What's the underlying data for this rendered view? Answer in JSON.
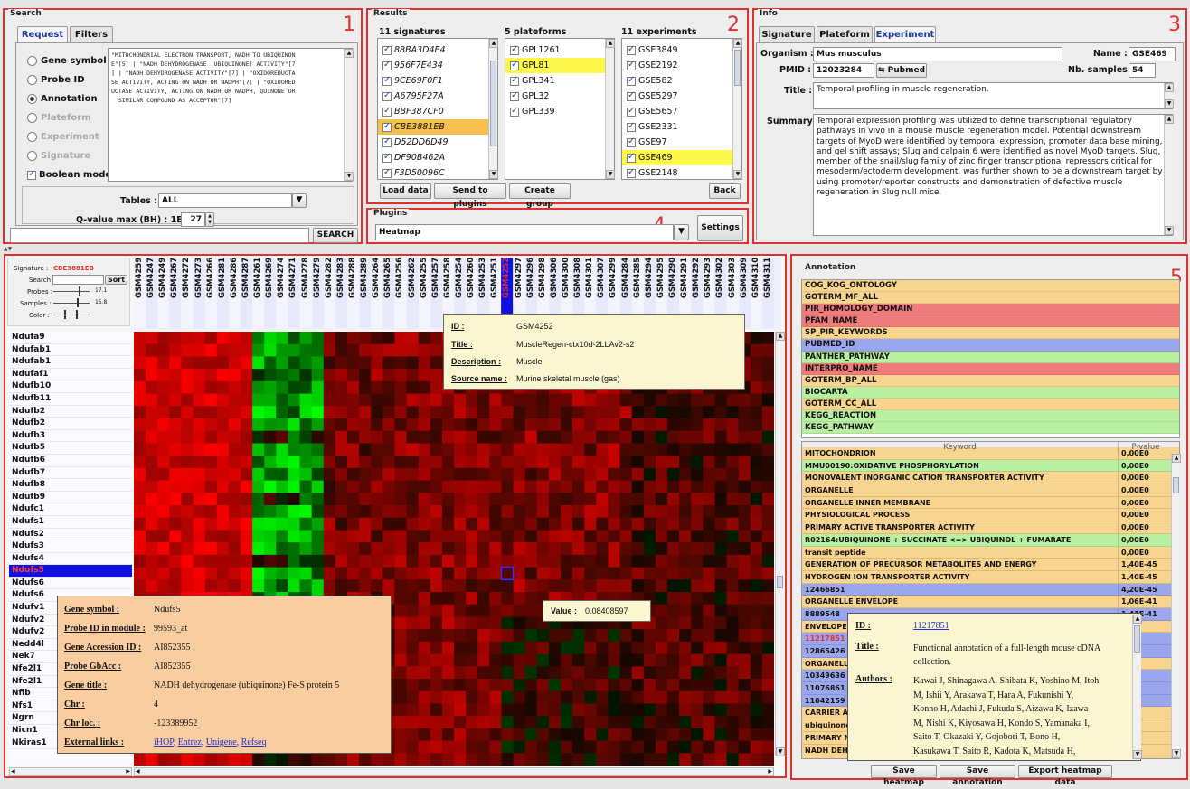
{
  "search": {
    "title": "Search",
    "tabs": [
      "Request",
      "Filters"
    ],
    "options": [
      {
        "label": "Gene symbol",
        "selected": false,
        "enabled": true
      },
      {
        "label": "Probe ID",
        "selected": false,
        "enabled": true
      },
      {
        "label": "Annotation",
        "selected": true,
        "enabled": true
      },
      {
        "label": "Plateform",
        "selected": false,
        "enabled": false
      },
      {
        "label": "Experiment",
        "selected": false,
        "enabled": false
      },
      {
        "label": "Signature",
        "selected": false,
        "enabled": false
      }
    ],
    "boolean_mode": "Boolean mode",
    "query_lines": [
      "\"MITOCHONDRIAL ELECTRON TRANSPORT, NADH TO UBIQUINON",
      "E\"[5] | \"NADH DEHYDROGENASE (UBIQUINONE) ACTIVITY\"[7",
      "] | \"NADH DEHYDROGENASE ACTIVITY\"[7] | \"OXIDOREDUCTA",
      "SE ACTIVITY, ACTING ON NADH OR NADPH\"[7] | \"OXIDORED",
      "UCTASE ACTIVITY, ACTING ON NADH OR NADPH, QUINONE OR",
      "  SIMILAR COMPOUND AS ACCEPTOR\"[7]"
    ],
    "tables_label": "Tables :",
    "tables_value": "ALL",
    "qvalue_label": "Q-value max (BH) : 1E-",
    "qvalue_value": "27",
    "search_button": "SEARCH"
  },
  "results": {
    "title": "Results",
    "signatures_header": "11 signatures",
    "platforms_header": "5 plateforms",
    "experiments_header": "11 experiments",
    "signatures": [
      {
        "id": "88BA3D4E4",
        "state": ""
      },
      {
        "id": "956F7E434",
        "state": ""
      },
      {
        "id": "9CE69F0F1",
        "state": ""
      },
      {
        "id": "A6795F27A",
        "state": ""
      },
      {
        "id": "BBF387CF0",
        "state": ""
      },
      {
        "id": "CBE3881EB",
        "state": "selected"
      },
      {
        "id": "D52DD6D49",
        "state": ""
      },
      {
        "id": "DF90B462A",
        "state": ""
      },
      {
        "id": "F3D50096C",
        "state": ""
      }
    ],
    "platforms": [
      {
        "id": "GPL1261",
        "state": ""
      },
      {
        "id": "GPL81",
        "state": "highlight"
      },
      {
        "id": "GPL341",
        "state": ""
      },
      {
        "id": "GPL32",
        "state": ""
      },
      {
        "id": "GPL339",
        "state": ""
      }
    ],
    "experiments": [
      {
        "id": "GSE3849",
        "state": ""
      },
      {
        "id": "GSE2192",
        "state": ""
      },
      {
        "id": "GSE582",
        "state": ""
      },
      {
        "id": "GSE5297",
        "state": ""
      },
      {
        "id": "GSE5657",
        "state": ""
      },
      {
        "id": "GSE2331",
        "state": ""
      },
      {
        "id": "GSE97",
        "state": ""
      },
      {
        "id": "GSE469",
        "state": "highlight"
      },
      {
        "id": "GSE2148",
        "state": ""
      }
    ],
    "buttons": [
      "Load data",
      "Send to plugins",
      "Create group",
      "Back"
    ]
  },
  "plugins": {
    "title": "Plugins",
    "value": "Heatmap",
    "settings": "Settings"
  },
  "info": {
    "title": "Info",
    "tabs": [
      "Signature",
      "Plateform",
      "Experiment"
    ],
    "organism_label": "Organism :",
    "organism": "Mus musculus",
    "name_label": "Name :",
    "name": "GSE469",
    "pmid_label": "PMID :",
    "pmid": "12023284",
    "pubmed_button": "Pubmed",
    "nb_samples_label": "Nb. samples :",
    "nb_samples": "54",
    "title_label": "Title :",
    "title_value": "Temporal profiling in muscle regeneration.",
    "summary_label": "Summary :",
    "summary_lines": [
      "Temporal expression profiling was utilized to define transcriptional regulatory",
      "pathways in vivo in a mouse muscle regeneration model. Potential downstream",
      "targets of MyoD were identified by temporal expression, promoter data base mining,",
      "and gel shift assays; Slug and calpain 6 were identified as novel MyoD targets. Slug, a",
      "member of the snail/slug family of zinc finger transcriptional repressors critical for",
      "mesoderm/ectoderm development, was further shown to be a downstream target by",
      "using promoter/reporter constructs and demonstration of defective muscle",
      "regeneration in Slug null mice."
    ]
  },
  "heatmap": {
    "signature_label": "Signature :",
    "signature_value": "CBE3881EB",
    "search_label": "Search :",
    "sort_button": "Sort",
    "probes_label": "Probes :",
    "probes_value": "17.1",
    "samples_label": "Samples :",
    "samples_value": "15.8",
    "color_label": "Color :",
    "columns": [
      "GSM4259",
      "GSM4247",
      "GSM4249",
      "GSM4267",
      "GSM4272",
      "GSM4273",
      "GSM4266",
      "GSM4281",
      "GSM4286",
      "GSM4287",
      "GSM4261",
      "GSM4269",
      "GSM4274",
      "GSM4271",
      "GSM4278",
      "GSM4279",
      "GSM4282",
      "GSM4283",
      "GSM4288",
      "GSM4289",
      "GSM4264",
      "GSM4265",
      "GSM4256",
      "GSM4262",
      "GSM4255",
      "GSM4257",
      "GSM4258",
      "GSM4254",
      "GSM4260",
      "GSM4253",
      "GSM4251",
      "GSM4252",
      "GSM4297",
      "GSM4296",
      "GSM4298",
      "GSM4306",
      "GSM4300",
      "GSM4308",
      "GSM4301",
      "GSM4307",
      "GSM4299",
      "GSM4284",
      "GSM4285",
      "GSM4294",
      "GSM4295",
      "GSM4290",
      "GSM4291",
      "GSM4292",
      "GSM4293",
      "GSM4302",
      "GSM4303",
      "GSM4309",
      "GSM4310",
      "GSM4311"
    ],
    "selected_column": "GSM4252",
    "genes": [
      "Ndufa9",
      "Ndufab1",
      "Ndufab1",
      "Ndufaf1",
      "Ndufb10",
      "Ndufb11",
      "Ndufb2",
      "Ndufb2",
      "Ndufb3",
      "Ndufb5",
      "Ndufb6",
      "Ndufb7",
      "Ndufb8",
      "Ndufb9",
      "Ndufc1",
      "Ndufs1",
      "Ndufs2",
      "Ndufs3",
      "Ndufs4",
      "Ndufs5",
      "Ndufs6",
      "Ndufs6",
      "Ndufv1",
      "Ndufv2",
      "Ndufv2",
      "Nedd4l",
      "Nek7",
      "Nfe2l1",
      "Nfe2l1",
      "Nfib",
      "Nfs1",
      "Ngrn",
      "Nicn1",
      "Nkiras1"
    ],
    "selected_gene": "Ndufs5",
    "value_tip": {
      "label": "Value :",
      "value": "0.08408597"
    },
    "sample_tip": {
      "id_label": "ID :",
      "id": "GSM4252",
      "title_label": "Title :",
      "title": "MuscleRegen-ctx10d-2LLAv2-s2",
      "desc_label": "Description :",
      "desc": "Muscle",
      "source_label": "Source name :",
      "source": "Murine skeletal muscle (gas)"
    },
    "gene_tip": {
      "symbol_label": "Gene symbol :",
      "symbol": "Ndufs5",
      "probe_label": "Probe ID in module :",
      "probe": "99593_at",
      "acc_label": "Gene Accession ID :",
      "acc": "AI852355",
      "gbacc_label": "Probe GbAcc :",
      "gbacc": "AI852355",
      "title_label": "Gene title :",
      "title": "NADH dehydrogenase (ubiquinone) Fe-S protein 5",
      "chr_label": "Chr :",
      "chr": "4",
      "loc_label": "Chr loc. :",
      "loc": "-123389952",
      "links_label": "External links :",
      "link_ihop": "iHOP",
      "link_entrez": "Entrez",
      "link_unigene": "Unigene",
      "link_refseq": "Refseq",
      "link_sep": ","
    }
  },
  "annotation": {
    "title": "Annotation",
    "categories": [
      {
        "name": "COG_KOG_ONTOLOGY",
        "color": "#f9d48e"
      },
      {
        "name": "GOTERM_MF_ALL",
        "color": "#f9d48e"
      },
      {
        "name": "PIR_HOMOLOGY_DOMAIN",
        "color": "#ef7b7b"
      },
      {
        "name": "PFAM_NAME",
        "color": "#ef7b7b"
      },
      {
        "name": "SP_PIR_KEYWORDS",
        "color": "#f9d48e"
      },
      {
        "name": "PUBMED_ID",
        "color": "#9aa7ef"
      },
      {
        "name": "PANTHER_PATHWAY",
        "color": "#b8efa0"
      },
      {
        "name": "INTERPRO_NAME",
        "color": "#ef7b7b"
      },
      {
        "name": "GOTERM_BP_ALL",
        "color": "#f9d48e"
      },
      {
        "name": "BIOCARTA",
        "color": "#b8efa0"
      },
      {
        "name": "GOTERM_CC_ALL",
        "color": "#f9d48e"
      },
      {
        "name": "KEGG_REACTION",
        "color": "#b8efa0"
      },
      {
        "name": "KEGG_PATHWAY",
        "color": "#b8efa0"
      }
    ],
    "keyword_header": "Keyword",
    "pvalue_header": "P-value",
    "keywords": [
      {
        "kw": "MITOCHONDRION",
        "p": "0,00E0",
        "color": "#f9d48e"
      },
      {
        "kw": "MMU00190:OXIDATIVE PHOSPHORYLATION",
        "p": "0,00E0",
        "color": "#b8efa0"
      },
      {
        "kw": "MONOVALENT INORGANIC CATION TRANSPORTER ACTIVITY",
        "p": "0,00E0",
        "color": "#f9d48e"
      },
      {
        "kw": "ORGANELLE",
        "p": "0,00E0",
        "color": "#f9d48e"
      },
      {
        "kw": "ORGANELLE INNER MEMBRANE",
        "p": "0,00E0",
        "color": "#f9d48e"
      },
      {
        "kw": "PHYSIOLOGICAL PROCESS",
        "p": "0,00E0",
        "color": "#f9d48e"
      },
      {
        "kw": "PRIMARY ACTIVE TRANSPORTER ACTIVITY",
        "p": "0,00E0",
        "color": "#f9d48e"
      },
      {
        "kw": "R02164:UBIQUINONE + SUCCINATE <=> UBIQUINOL + FUMARATE",
        "p": "0,00E0",
        "color": "#b8efa0"
      },
      {
        "kw": "transit peptide",
        "p": "0,00E0",
        "color": "#f9d48e"
      },
      {
        "kw": "GENERATION OF PRECURSOR METABOLITES AND ENERGY",
        "p": "1,40E-45",
        "color": "#f9d48e"
      },
      {
        "kw": "HYDROGEN ION TRANSPORTER ACTIVITY",
        "p": "1,40E-45",
        "color": "#f9d48e"
      },
      {
        "kw": "12466851",
        "p": "4,20E-45",
        "color": "#9aa7ef"
      },
      {
        "kw": "ORGANELLE ENVELOPE",
        "p": "1,06E-41",
        "color": "#f9d48e"
      },
      {
        "kw": "8889548",
        "p": "1,41E-41",
        "color": "#9aa7ef"
      },
      {
        "kw": "ENVELOPE",
        "p": "",
        "color": "#f9d48e"
      },
      {
        "kw": "11217851",
        "p": "",
        "color": "#9aa7ef",
        "selected": true
      },
      {
        "kw": "12865426",
        "p": "",
        "color": "#9aa7ef"
      },
      {
        "kw": "ORGANELLE",
        "p": "",
        "color": "#f9d48e"
      },
      {
        "kw": "10349636",
        "p": "",
        "color": "#9aa7ef"
      },
      {
        "kw": "11076861",
        "p": "",
        "color": "#9aa7ef"
      },
      {
        "kw": "11042159",
        "p": "",
        "color": "#9aa7ef"
      },
      {
        "kw": "CARRIER A",
        "p": "",
        "color": "#f9d48e"
      },
      {
        "kw": "ubiquinone",
        "p": "",
        "color": "#f9d48e"
      },
      {
        "kw": "PRIMARY M",
        "p": "",
        "color": "#f9d48e"
      },
      {
        "kw": "NADH DEHY",
        "p": "",
        "color": "#f9d48e"
      },
      {
        "kw": "NADH DEHY",
        "p": "",
        "color": "#f9d48e"
      }
    ],
    "pub_tip": {
      "id_label": "ID :",
      "id": "11217851",
      "title_label": "Title :",
      "title_lines": [
        "Functional annotation of a full-length mouse cDNA",
        "collection."
      ],
      "authors_label": "Authors :",
      "authors_lines": [
        "Kawai J, Shinagawa A, Shibata K, Yoshino M, Itoh",
        "M, Ishii Y, Arakawa T, Hara A, Fukunishi Y,",
        "Konno H, Adachi J, Fukuda S, Aizawa K, Izawa",
        "M, Nishi K, Kiyosawa H, Kondo S, Yamanaka I,",
        "Saito T, Okazaki Y, Gojobori T, Bono H,",
        "Kasukawa T, Saito R, Kadota K, Matsuda H,"
      ]
    },
    "buttons": [
      "Save heatmap",
      "Save annotation",
      "Export heatmap data"
    ]
  },
  "panel_numbers": [
    "1",
    "2",
    "3",
    "4",
    "5"
  ],
  "colors": {
    "panel_border": "#e03030",
    "heat_high": "#ff0000",
    "heat_low": "#00ff00",
    "selected_gene": "#1010e0"
  }
}
